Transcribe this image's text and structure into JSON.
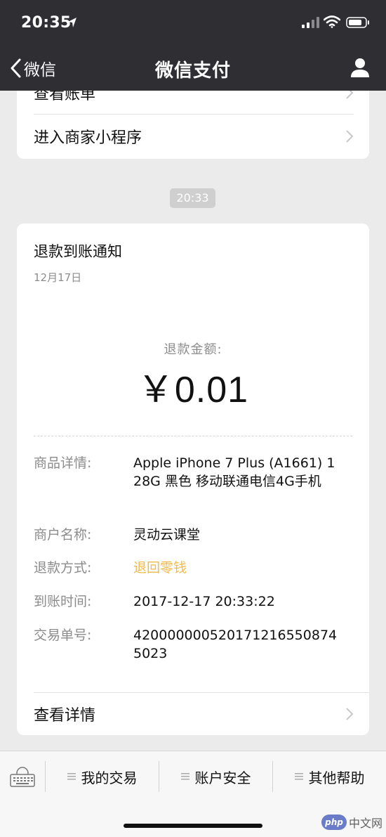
{
  "status_bar": {
    "time": "20:35",
    "icons": [
      "location-arrow-icon",
      "cellular-signal-icon",
      "wifi-icon",
      "battery-icon"
    ]
  },
  "nav": {
    "back_label": "微信",
    "title": "微信支付",
    "icons": [
      "chevron-left-icon",
      "profile-icon"
    ]
  },
  "top_card": {
    "row1_label": "查看账单",
    "row2_label": "进入商家小程序"
  },
  "timestamp": "20:33",
  "notice": {
    "title": "退款到账通知",
    "date": "12月17日",
    "amount_label": "退款金额:",
    "amount_value": "￥0.01",
    "details": [
      {
        "label": "商品详情:",
        "value": "Apple iPhone 7 Plus (A1661) 128G 黑色 移动联通电信4G手机"
      },
      {
        "label": "商户名称:",
        "value": "灵动云课堂"
      },
      {
        "label": "退款方式:",
        "value": "退回零钱"
      },
      {
        "label": "到账时间:",
        "value": "2017-12-17 20:33:22"
      },
      {
        "label": "交易单号:",
        "value": "4200000005201712165508745023"
      }
    ],
    "view_detail_label": "查看详情"
  },
  "bottom_menu": {
    "items": [
      "我的交易",
      "账户安全",
      "其他帮助"
    ],
    "icons": [
      "keyboard-icon",
      "menu-lines-icon"
    ]
  },
  "watermark": {
    "badge": "php",
    "text": "中文网"
  },
  "colors": {
    "nav_bg": "#2e2e33",
    "page_bg": "#ebebeb",
    "accent": "#f0ba4a",
    "muted": "#8c8c8c"
  }
}
